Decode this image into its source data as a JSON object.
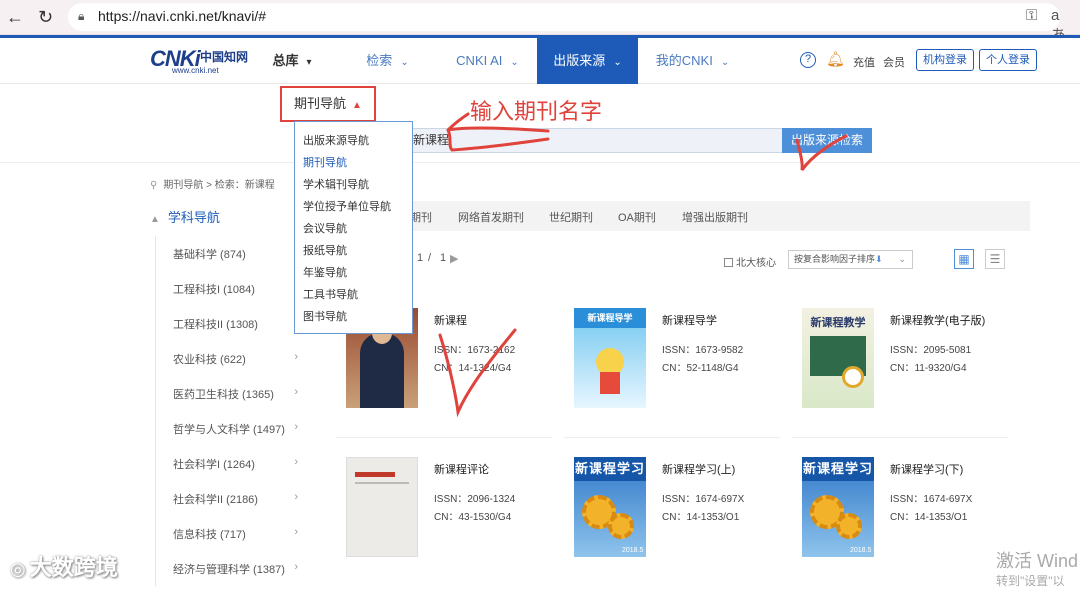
{
  "browser": {
    "url": "https://navi.cnki.net/knavi/#"
  },
  "header": {
    "logo_text": "CNKi",
    "logo_cn": "中国知网",
    "logo_url": "www.cnki.net",
    "nav": [
      {
        "label": "总库"
      },
      {
        "label": "检索"
      },
      {
        "label": "CNKI AI"
      },
      {
        "label": "出版来源"
      },
      {
        "label": "我的CNKI"
      }
    ],
    "recharge": "充值",
    "member": "会员",
    "org_login": "机构登录",
    "personal_login": "个人登录"
  },
  "search": {
    "dropdown_label": "期刊导航",
    "annotation": "输入期刊名字",
    "query": "新课程",
    "button": "出版来源检索"
  },
  "dropdown_items": [
    "出版来源导航",
    "期刊导航",
    "学术辑刊导航",
    "学位授予单位导航",
    "会议导航",
    "报纸导航",
    "年鉴导航",
    "工具书导航",
    "图书导航"
  ],
  "breadcrumb": "期刊导航  >  检索：新课程",
  "sidebar": {
    "title": "学科导航",
    "items": [
      "基础科学 (874)",
      "工程科技I (1084)",
      "工程科技II (1308)",
      "农业科技 (622)",
      "医药卫生科技 (1365)",
      "哲学与人文科学 (1497)",
      "社会科学I (1264)",
      "社会科学II (2186)",
      "信息科技 (717)",
      "经济与管理科学 (1387)"
    ]
  },
  "tabs": [
    "期刊",
    "网络首发期刊",
    "世纪期刊",
    "OA期刊",
    "增强出版期刊"
  ],
  "pager": {
    "current": "1",
    "sep": "/",
    "total": "1"
  },
  "filter": {
    "core_label": "北大核心",
    "sort_label": "按复合影响因子排序"
  },
  "results": [
    {
      "title": "新课程",
      "issn": "ISSN：1673-2162",
      "cn": "CN：14-1324/G4"
    },
    {
      "title": "新课程导学",
      "issn": "ISSN：1673-9582",
      "cn": "CN：52-1148/G4",
      "cover_text": "新课程导学"
    },
    {
      "title": "新课程教学(电子版)",
      "issn": "ISSN：2095-5081",
      "cn": "CN：11-9320/G4",
      "cover_text": "新课程教学"
    },
    {
      "title": "新课程评论",
      "issn": "ISSN：2096-1324",
      "cn": "CN：43-1530/G4"
    },
    {
      "title": "新课程学习(上)",
      "issn": "ISSN：1674-697X",
      "cn": "CN：14-1353/O1",
      "cover_text": "新课程学习",
      "cover_year": "2018.5"
    },
    {
      "title": "新课程学习(下)",
      "issn": "ISSN：1674-697X",
      "cn": "CN：14-1353/O1",
      "cover_text": "新课程学习",
      "cover_year": "2018.5"
    }
  ],
  "watermark": {
    "left": "大数跨境",
    "activate_line1": "激活 Wind",
    "activate_line2": "转到\"设置\"以"
  },
  "colors": {
    "primary": "#1e5bb8",
    "annotation_red": "#e0423c"
  }
}
